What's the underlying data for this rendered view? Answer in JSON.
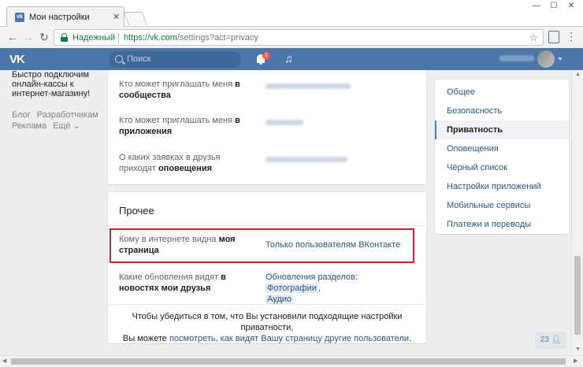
{
  "browser": {
    "tab_title": "Мои настройки",
    "tab_favicon": "vk-favicon",
    "secure_label": "Надежный",
    "url_host": "https://vk.com",
    "url_path": "/settings?act=privacy"
  },
  "header": {
    "logo": "VK",
    "search_placeholder": "Поиск",
    "notifications_count": "1"
  },
  "left": {
    "promo_text": "Быстро подключим онлайн-кассы к интернет-магазину!",
    "links": [
      "Блог",
      "Разработчикам",
      "Реклама",
      "Ещё ⌄"
    ]
  },
  "privacy_rows": [
    {
      "label_plain": "Кто может приглашать меня ",
      "label_bold": "в сообщества"
    },
    {
      "label_plain": "Кто может приглашать меня ",
      "label_bold": "в приложения"
    },
    {
      "label_plain": "О каких заявках в друзья приходят ",
      "label_bold": "оповещения"
    }
  ],
  "other": {
    "title": "Прочее",
    "page_visibility_label_plain": "Кому в интернете видна ",
    "page_visibility_label_bold": "моя страница",
    "page_visibility_value": "Только пользователям ВКонтакте",
    "updates_label_plain": "Какие обновления видят ",
    "updates_label_bold": "в новостях мои друзья",
    "updates_value_prefix": "Обновления разделов:",
    "updates_chip_1": "Фотографии",
    "updates_chip_2": "Аудио",
    "footer_line1": "Чтобы убедиться в том, что Вы установили подходящие настройки приватности,",
    "footer_line2_prefix": "Вы можете ",
    "footer_line2_link": "посмотреть, как видят Вашу страницу другие пользователи",
    "footer_line2_suffix": "."
  },
  "settings_menu": [
    "Общее",
    "Безопасность",
    "Приватность",
    "Оповещения",
    "Чёрный список",
    "Настройки приложений",
    "Мобильные сервисы",
    "Платежи и переводы"
  ],
  "settings_menu_active": "Приватность",
  "online_counter": "23",
  "colors": {
    "header_blue": "#4a76a8",
    "link_blue": "#2a5885",
    "highlight_red": "#d9262e",
    "secure_green": "#0b8043"
  }
}
